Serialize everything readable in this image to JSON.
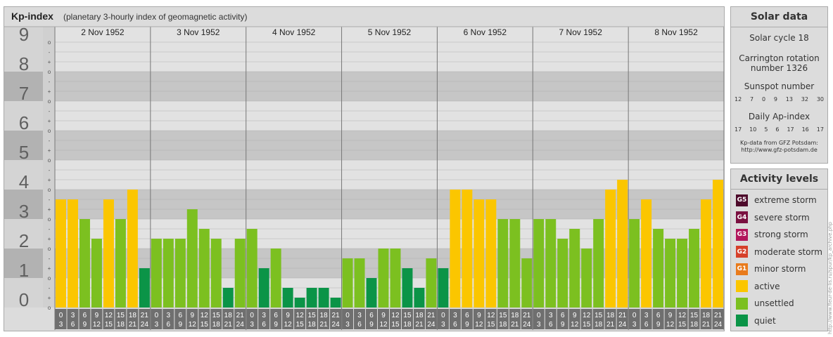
{
  "header": {
    "title": "Kp-index",
    "subtitle": "(planetary 3-hourly index of geomagnetic activity)"
  },
  "chart_data": {
    "type": "bar",
    "ylim": [
      0,
      9
    ],
    "y_ticks": [
      "0",
      "1",
      "2",
      "3",
      "4",
      "5",
      "6",
      "7",
      "8",
      "9"
    ],
    "sub_ticks": [
      "o",
      "+",
      "-"
    ],
    "days": [
      "2 Nov 1952",
      "3 Nov 1952",
      "4 Nov 1952",
      "5 Nov 1952",
      "6 Nov 1952",
      "7 Nov 1952",
      "8 Nov 1952"
    ],
    "hour_labels": [
      [
        "0",
        "3"
      ],
      [
        "3",
        "6"
      ],
      [
        "6",
        "9"
      ],
      [
        "9",
        "12"
      ],
      [
        "12",
        "15"
      ],
      [
        "15",
        "18"
      ],
      [
        "18",
        "21"
      ],
      [
        "21",
        "24"
      ]
    ],
    "values": [
      [
        3.667,
        3.667,
        3.0,
        2.333,
        3.667,
        3.0,
        4.0,
        1.333
      ],
      [
        2.333,
        2.333,
        2.333,
        3.333,
        2.667,
        2.333,
        0.667,
        2.333
      ],
      [
        2.667,
        1.333,
        2.0,
        0.667,
        0.333,
        0.667,
        0.667,
        0.333
      ],
      [
        1.667,
        1.667,
        1.0,
        2.0,
        2.0,
        1.333,
        0.667,
        1.667
      ],
      [
        1.333,
        4.0,
        4.0,
        3.667,
        3.667,
        3.0,
        3.0,
        1.667
      ],
      [
        3.0,
        3.0,
        2.333,
        2.667,
        2.0,
        3.0,
        4.0,
        4.333
      ],
      [
        3.0,
        3.667,
        2.667,
        2.333,
        2.333,
        2.667,
        3.667,
        4.333
      ]
    ],
    "colors": {
      "quiet": "#0b9447",
      "unsettled": "#7cc020",
      "active": "#fbc600",
      "band_dark": "#c6c6c6",
      "band_light": "#e2e2e2",
      "label_dark": "#b2b2b2",
      "label_light": "#d4d4d4",
      "hour_box": "#6f6f6f"
    }
  },
  "solar": {
    "title": "Solar data",
    "cycle": "Solar cycle 18",
    "carrington_1": "Carrington rotation",
    "carrington_2": "number 1326",
    "sunspot_title": "Sunspot number",
    "sunspot_values": [
      "12",
      "7",
      "0",
      "9",
      "13",
      "32",
      "30"
    ],
    "ap_title": "Daily Ap-index",
    "ap_values": [
      "17",
      "10",
      "5",
      "6",
      "17",
      "16",
      "17"
    ],
    "credit_1": "Kp-data from GFZ Potsdam:",
    "credit_2": "http://www.gfz-potsdam.de"
  },
  "activity": {
    "title": "Activity levels",
    "items": [
      {
        "code": "G5",
        "label": "extreme storm",
        "color": "#4d0a2b"
      },
      {
        "code": "G4",
        "label": "severe storm",
        "color": "#7a1040"
      },
      {
        "code": "G3",
        "label": "strong storm",
        "color": "#b2165b"
      },
      {
        "code": "G2",
        "label": "moderate storm",
        "color": "#d6402a"
      },
      {
        "code": "G1",
        "label": "minor storm",
        "color": "#e97b1c"
      },
      {
        "code": "",
        "label": "active",
        "color": "#fbc600"
      },
      {
        "code": "",
        "label": "unsettled",
        "color": "#7cc020"
      },
      {
        "code": "",
        "label": "quiet",
        "color": "#0b9447"
      }
    ]
  },
  "side_note": "http://www.fleur-de-lis.ru/spur/kp_archive.php"
}
